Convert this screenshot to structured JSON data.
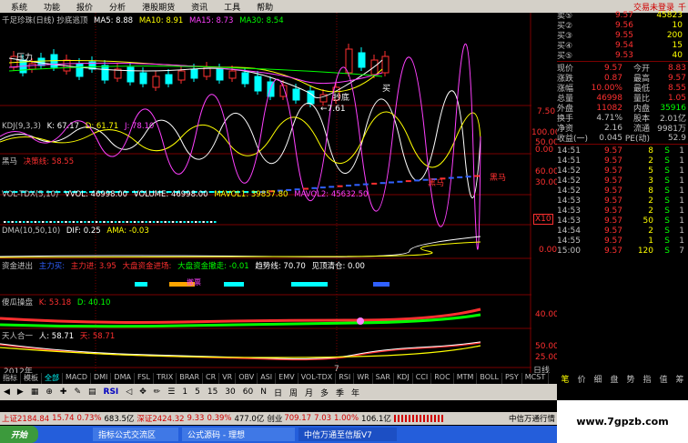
{
  "menu": {
    "items": [
      "系统",
      "功能",
      "报价",
      "分析",
      "港股期货",
      "资讯",
      "工具",
      "帮助"
    ],
    "warning": "交易未登录",
    "close": "千"
  },
  "main": {
    "title": "千足珍珠(日线) 抄底逃顶",
    "ma5": "MA5: 8.88",
    "ma10": "MA10: 8.91",
    "ma15": "MA15: 8.73",
    "ma30": "MA30: 8.54",
    "annot_pressure": "压力",
    "annot_bottom": "抄底",
    "annot_low": "←7.61",
    "annot_buy": "买"
  },
  "kdj": {
    "title": "KDJ(9,3,3)",
    "k": "K: 67.17",
    "d": "D: 61.71",
    "j": "J: 78.10"
  },
  "hm": {
    "title": "黑马",
    "decision": "决策线: 58.55",
    "label1": "黑马",
    "label2": "黑马"
  },
  "vol": {
    "title": "VOL-TDX(5,10)",
    "vvol": "VVOL: 46998.00",
    "volume": "VOLUME: 46998.00",
    "mavol1": "MAVOL1: 39857.80",
    "mavol2": "MAVOL2: 45632.50"
  },
  "dma": {
    "title": "DMA(10,50,10)",
    "dif": "DIF: 0.25",
    "ama": "AMA: -0.03"
  },
  "flow": {
    "title": "资金进出",
    "a": "主力买:",
    "b": "主力进: 3.95",
    "c": "大盘资金进场:",
    "d": "大盘资金撤走: -0.01",
    "e": "趋势线: 70.70",
    "f": "见顶清仓: 0.00",
    "note": "撤票"
  },
  "gua": {
    "title": "傻瓜操盘",
    "k": "K: 53.18",
    "d": "D: 40.10"
  },
  "tr": {
    "title": "天人合一",
    "ren": "人: 58.71",
    "tian": "天: 58.71"
  },
  "axis": {
    "main": "7.50",
    "kdj": [
      "100.00",
      "50.00",
      "0.00"
    ],
    "hm": [
      "60.00",
      "30.00"
    ],
    "vol": "X10",
    "dma": "0.00",
    "gua": "40.00",
    "tr": [
      "50.00",
      "25.00"
    ],
    "date": "日线"
  },
  "xaxis": {
    "year": "2012年",
    "mark": "7"
  },
  "quote": {
    "top": [
      [
        "卖⑤",
        "9.57",
        "45823"
      ]
    ],
    "buys": [
      [
        "买②",
        "9.56",
        "10"
      ],
      [
        "买③",
        "9.55",
        "200"
      ],
      [
        "买④",
        "9.54",
        "15"
      ],
      [
        "买⑤",
        "9.53",
        "40"
      ]
    ],
    "stats": [
      [
        "现价",
        "9.57",
        "今开",
        "8.83"
      ],
      [
        "涨跌",
        "0.87",
        "最高",
        "9.57"
      ],
      [
        "涨幅",
        "10.00%",
        "最低",
        "8.55"
      ],
      [
        "总量",
        "46998",
        "量比",
        "1.05"
      ],
      [
        "外盘",
        "11082",
        "内盘",
        "35916"
      ],
      [
        "换手",
        "4.71%",
        "股本",
        "2.01亿"
      ],
      [
        "净资",
        "2.16",
        "流通",
        "9981万"
      ],
      [
        "收益(一)",
        "0.045",
        "PE(动)",
        "52.9"
      ]
    ],
    "ticks": [
      [
        "14:51",
        "9.57",
        "8",
        "S",
        "1"
      ],
      [
        "14:51",
        "9.57",
        "2",
        "S",
        "1"
      ],
      [
        "14:52",
        "9.57",
        "5",
        "S",
        "1"
      ],
      [
        "14:52",
        "9.57",
        "3",
        "S",
        "1"
      ],
      [
        "14:52",
        "9.57",
        "8",
        "S",
        "1"
      ],
      [
        "14:53",
        "9.57",
        "2",
        "S",
        "1"
      ],
      [
        "14:53",
        "9.57",
        "2",
        "S",
        "1"
      ],
      [
        "14:53",
        "9.57",
        "50",
        "S",
        "1"
      ],
      [
        "14:54",
        "9.57",
        "2",
        "S",
        "1"
      ],
      [
        "14:55",
        "9.57",
        "1",
        "S",
        "1"
      ],
      [
        "15:00",
        "9.57",
        "120",
        "S",
        "7"
      ]
    ]
  },
  "tabs": [
    "指标",
    "模板",
    "全部",
    "MACD",
    "DMI",
    "DMA",
    "FSL",
    "TRIX",
    "BRAR",
    "CR",
    "VR",
    "OBV",
    "ASI",
    "EMV",
    "VOL-TDX",
    "RSI",
    "WR",
    "SAR",
    "KDJ",
    "CCI",
    "ROC",
    "MTM",
    "BOLL",
    "PSY",
    "MCST"
  ],
  "rtabs": [
    "笔",
    "价",
    "细",
    "盘",
    "势",
    "指",
    "值",
    "筹"
  ],
  "toolbar": [
    "1",
    "5",
    "15",
    "30",
    "60",
    "N",
    "日",
    "周",
    "月",
    "多",
    "季",
    "年"
  ],
  "status": {
    "sh": "上证2184.84",
    "sh_chg": "15.74",
    "sh_pct": "0.73%",
    "sh_amt": "683.5亿",
    "sz": "深证2424.32",
    "sz_chg": "9.33",
    "sz_pct": "0.39%",
    "sz_amt": "477.0亿",
    "cy": "创业",
    "cy_val": "709.17",
    "cy_chg": "7.03",
    "cy_pct": "1.00%",
    "cy_amt": "106.1亿",
    "broker": "中信万通行情"
  },
  "taskbar": {
    "start": "开始",
    "items": [
      "指标公式交流区",
      "公式源码 - 理想",
      "中信万通至信版V7"
    ]
  },
  "logo": "www.7gpzb.com",
  "colors": {
    "up": "#ff3030",
    "down": "#00ffff",
    "yellow": "#ffff00",
    "green": "#00ff00",
    "magenta": "#ff40ff",
    "white": "#ffffff"
  }
}
